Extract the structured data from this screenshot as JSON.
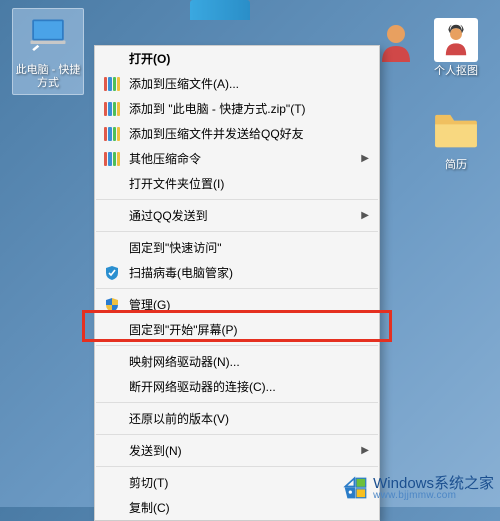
{
  "desktop": {
    "this_pc": {
      "label": "此电脑 - 快捷方式"
    },
    "person": {
      "label": "个人抠图"
    },
    "folder": {
      "label": "简历"
    }
  },
  "menu": {
    "open": "打开(O)",
    "add_archive": "添加到压缩文件(A)...",
    "add_zip": "添加到 \"此电脑 - 快捷方式.zip\"(T)",
    "add_send_qq": "添加到压缩文件并发送给QQ好友",
    "other_archive": "其他压缩命令",
    "open_location": "打开文件夹位置(I)",
    "send_qq": "通过QQ发送到",
    "pin_quick": "固定到\"快速访问\"",
    "scan_virus": "扫描病毒(电脑管家)",
    "manage": "管理(G)",
    "pin_start": "固定到\"开始\"屏幕(P)",
    "map_drive": "映射网络驱动器(N)...",
    "disconnect_drive": "断开网络驱动器的连接(C)...",
    "restore": "还原以前的版本(V)",
    "send_to": "发送到(N)",
    "cut": "剪切(T)",
    "copy": "复制(C)"
  },
  "watermark": {
    "main": "Windows系统之家",
    "sub": "www.bjjmmw.com"
  },
  "colors": {
    "books": [
      "#e05a4a",
      "#3a8fd8",
      "#4fbf5a",
      "#f0c040"
    ],
    "highlight": "#e53020"
  }
}
